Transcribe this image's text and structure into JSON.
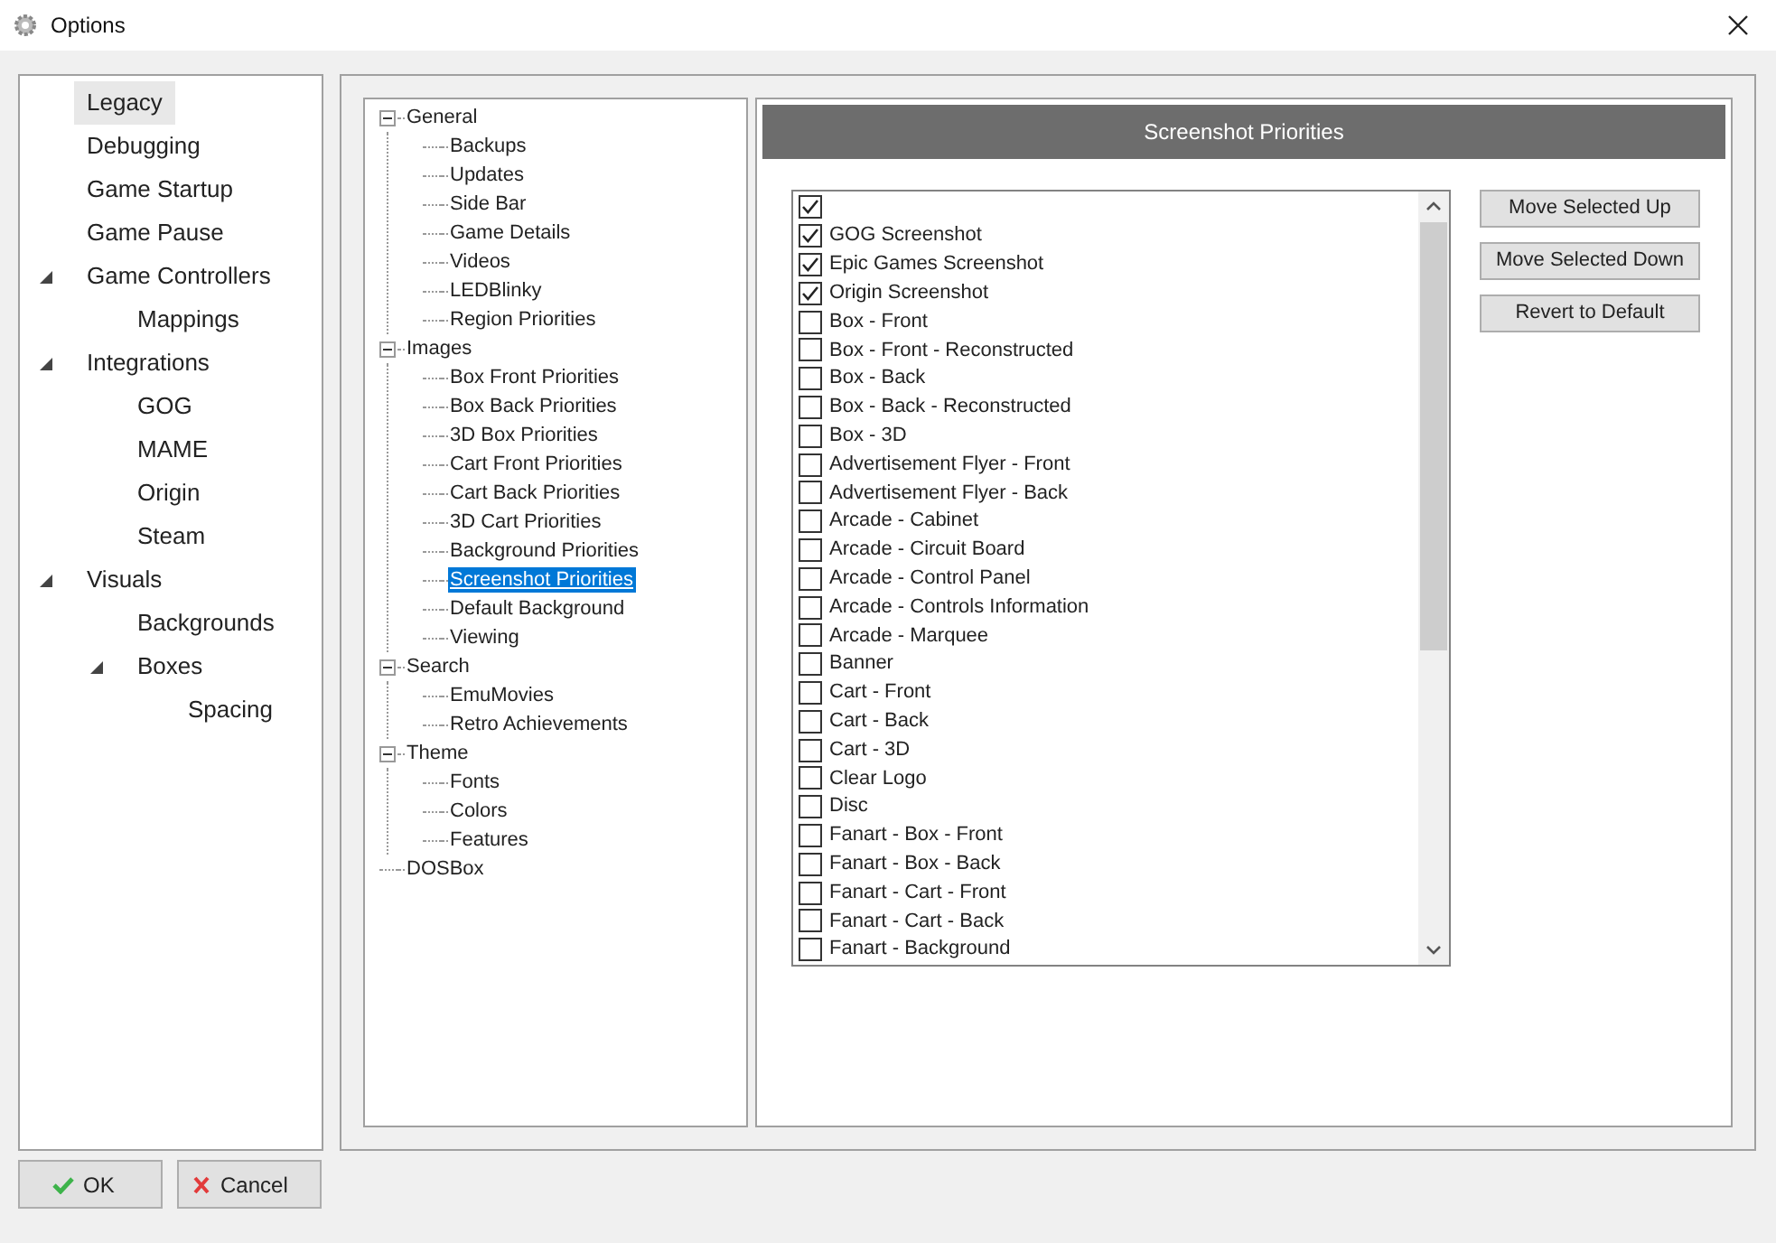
{
  "window": {
    "title": "Options"
  },
  "nav": [
    {
      "label": "Legacy",
      "selected": true
    },
    {
      "label": "Debugging",
      "selected": false
    },
    {
      "label": "Game Startup",
      "selected": false
    },
    {
      "label": "Game Pause",
      "selected": false
    },
    {
      "label": "Game Controllers",
      "selected": false,
      "expanded": true,
      "children": [
        {
          "label": "Mappings",
          "selected": false
        }
      ]
    },
    {
      "label": "Integrations",
      "selected": false,
      "expanded": true,
      "children": [
        {
          "label": "GOG",
          "selected": false
        },
        {
          "label": "MAME",
          "selected": false
        },
        {
          "label": "Origin",
          "selected": false
        },
        {
          "label": "Steam",
          "selected": false
        }
      ]
    },
    {
      "label": "Visuals",
      "selected": false,
      "expanded": true,
      "children": [
        {
          "label": "Backgrounds",
          "selected": false
        },
        {
          "label": "Boxes",
          "selected": false,
          "expanded": true,
          "children": [
            {
              "label": "Spacing",
              "selected": false
            }
          ]
        }
      ]
    }
  ],
  "tree": [
    {
      "label": "General",
      "selected": false,
      "expanded": true,
      "children": [
        {
          "label": "Backups",
          "selected": false
        },
        {
          "label": "Updates",
          "selected": false
        },
        {
          "label": "Side Bar",
          "selected": false
        },
        {
          "label": "Game Details",
          "selected": false
        },
        {
          "label": "Videos",
          "selected": false
        },
        {
          "label": "LEDBlinky",
          "selected": false
        },
        {
          "label": "Region Priorities",
          "selected": false
        }
      ]
    },
    {
      "label": "Images",
      "selected": false,
      "expanded": true,
      "children": [
        {
          "label": "Box Front Priorities",
          "selected": false
        },
        {
          "label": "Box Back Priorities",
          "selected": false
        },
        {
          "label": "3D Box Priorities",
          "selected": false
        },
        {
          "label": "Cart Front Priorities",
          "selected": false
        },
        {
          "label": "Cart Back Priorities",
          "selected": false
        },
        {
          "label": "3D Cart Priorities",
          "selected": false
        },
        {
          "label": "Background Priorities",
          "selected": false
        },
        {
          "label": "Screenshot Priorities",
          "selected": true
        },
        {
          "label": "Default Background",
          "selected": false
        },
        {
          "label": "Viewing",
          "selected": false
        }
      ]
    },
    {
      "label": "Search",
      "selected": false,
      "expanded": true,
      "children": [
        {
          "label": "EmuMovies",
          "selected": false
        },
        {
          "label": "Retro Achievements",
          "selected": false
        }
      ]
    },
    {
      "label": "Theme",
      "selected": false,
      "expanded": true,
      "children": [
        {
          "label": "Fonts",
          "selected": false
        },
        {
          "label": "Colors",
          "selected": false
        },
        {
          "label": "Features",
          "selected": false
        }
      ]
    },
    {
      "label": "DOSBox",
      "selected": false
    }
  ],
  "panel": {
    "title": "Screenshot Priorities",
    "items": [
      {
        "checked": true
      },
      {
        "label": "GOG Screenshot",
        "checked": true
      },
      {
        "label": "Epic Games Screenshot",
        "checked": true
      },
      {
        "label": "Origin Screenshot",
        "checked": true
      },
      {
        "label": "Box - Front",
        "checked": false
      },
      {
        "label": "Box - Front - Reconstructed",
        "checked": false
      },
      {
        "label": "Box - Back",
        "checked": false
      },
      {
        "label": "Box - Back - Reconstructed",
        "checked": false
      },
      {
        "label": "Box - 3D",
        "checked": false
      },
      {
        "label": "Advertisement Flyer - Front",
        "checked": false
      },
      {
        "label": "Advertisement Flyer - Back",
        "checked": false
      },
      {
        "label": "Arcade - Cabinet",
        "checked": false
      },
      {
        "label": "Arcade - Circuit Board",
        "checked": false
      },
      {
        "label": "Arcade - Control Panel",
        "checked": false
      },
      {
        "label": "Arcade - Controls Information",
        "checked": false
      },
      {
        "label": "Arcade - Marquee",
        "checked": false
      },
      {
        "label": "Banner",
        "checked": false
      },
      {
        "label": "Cart - Front",
        "checked": false
      },
      {
        "label": "Cart - Back",
        "checked": false
      },
      {
        "label": "Cart - 3D",
        "checked": false
      },
      {
        "label": "Clear Logo",
        "checked": false
      },
      {
        "label": "Disc",
        "checked": false
      },
      {
        "label": "Fanart - Box - Front",
        "checked": false
      },
      {
        "label": "Fanart - Box - Back",
        "checked": false
      },
      {
        "label": "Fanart - Cart - Front",
        "checked": false
      },
      {
        "label": "Fanart - Cart - Back",
        "checked": false
      },
      {
        "label": "Fanart - Background",
        "checked": false
      }
    ],
    "buttons": [
      "Move Selected Up",
      "Move Selected Down",
      "Revert to Default"
    ]
  },
  "footer": {
    "ok": "OK",
    "cancel": "Cancel"
  }
}
